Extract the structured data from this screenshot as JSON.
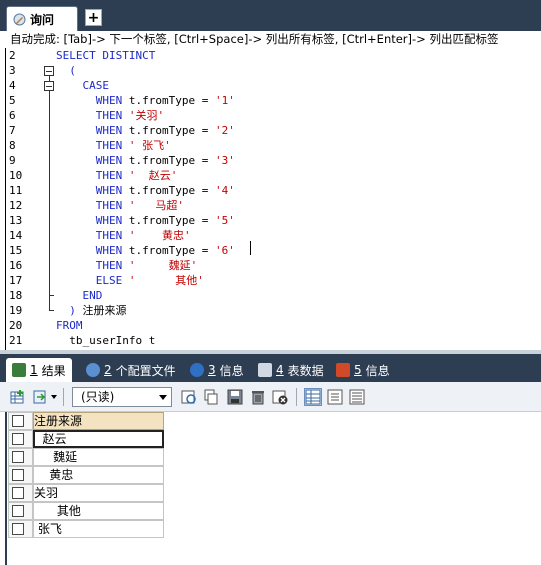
{
  "top_tab": {
    "label": "询问",
    "add_label": "+"
  },
  "hint": "自动完成: [Tab]-> 下一个标签, [Ctrl+Space]-> 列出所有标签, [Ctrl+Enter]-> 列出匹配标签",
  "code_lines": [
    {
      "n": "2",
      "parts": [
        {
          "t": "SELECT DISTINCT",
          "c": "kw"
        }
      ]
    },
    {
      "n": "3",
      "parts": [
        {
          "t": "  (",
          "c": "kw"
        }
      ]
    },
    {
      "n": "4",
      "parts": [
        {
          "t": "    CASE",
          "c": "kw"
        }
      ]
    },
    {
      "n": "5",
      "parts": [
        {
          "t": "      WHEN ",
          "c": "kw"
        },
        {
          "t": "t.fromType = ",
          "c": "plain"
        },
        {
          "t": "'1'",
          "c": "str"
        }
      ]
    },
    {
      "n": "6",
      "parts": [
        {
          "t": "      THEN ",
          "c": "kw"
        },
        {
          "t": "'关羽'",
          "c": "str"
        }
      ]
    },
    {
      "n": "7",
      "parts": [
        {
          "t": "      WHEN ",
          "c": "kw"
        },
        {
          "t": "t.fromType = ",
          "c": "plain"
        },
        {
          "t": "'2'",
          "c": "str"
        }
      ]
    },
    {
      "n": "8",
      "parts": [
        {
          "t": "      THEN ",
          "c": "kw"
        },
        {
          "t": "' 张飞'",
          "c": "str"
        }
      ]
    },
    {
      "n": "9",
      "parts": [
        {
          "t": "      WHEN ",
          "c": "kw"
        },
        {
          "t": "t.fromType = ",
          "c": "plain"
        },
        {
          "t": "'3'",
          "c": "str"
        }
      ]
    },
    {
      "n": "10",
      "parts": [
        {
          "t": "      THEN ",
          "c": "kw"
        },
        {
          "t": "'  赵云'",
          "c": "str"
        }
      ]
    },
    {
      "n": "11",
      "parts": [
        {
          "t": "      WHEN ",
          "c": "kw"
        },
        {
          "t": "t.fromType = ",
          "c": "plain"
        },
        {
          "t": "'4'",
          "c": "str"
        }
      ]
    },
    {
      "n": "12",
      "parts": [
        {
          "t": "      THEN ",
          "c": "kw"
        },
        {
          "t": "'   马超'",
          "c": "str"
        }
      ]
    },
    {
      "n": "13",
      "parts": [
        {
          "t": "      WHEN ",
          "c": "kw"
        },
        {
          "t": "t.fromType = ",
          "c": "plain"
        },
        {
          "t": "'5'",
          "c": "str"
        }
      ]
    },
    {
      "n": "14",
      "parts": [
        {
          "t": "      THEN ",
          "c": "kw"
        },
        {
          "t": "'    黄忠'",
          "c": "str"
        }
      ]
    },
    {
      "n": "15",
      "parts": [
        {
          "t": "      WHEN ",
          "c": "kw"
        },
        {
          "t": "t.fromType = ",
          "c": "plain"
        },
        {
          "t": "'6'",
          "c": "str"
        }
      ]
    },
    {
      "n": "16",
      "parts": [
        {
          "t": "      THEN ",
          "c": "kw"
        },
        {
          "t": "'     魏延'",
          "c": "str"
        }
      ]
    },
    {
      "n": "17",
      "parts": [
        {
          "t": "      ELSE ",
          "c": "kw"
        },
        {
          "t": "'      其他'",
          "c": "str"
        }
      ]
    },
    {
      "n": "18",
      "parts": [
        {
          "t": "    END",
          "c": "kw"
        }
      ]
    },
    {
      "n": "19",
      "parts": [
        {
          "t": "  ) ",
          "c": "kw"
        },
        {
          "t": "注册来源",
          "c": "plain"
        }
      ]
    },
    {
      "n": "20",
      "parts": [
        {
          "t": "FROM",
          "c": "kw"
        }
      ]
    },
    {
      "n": "21",
      "parts": [
        {
          "t": "  tb_userInfo t",
          "c": "plain"
        }
      ]
    }
  ],
  "result_tabs": [
    {
      "num": "1",
      "label": "结果",
      "icon": "result-grid-icon",
      "active": true
    },
    {
      "num": "2",
      "label": "个配置文件",
      "icon": "profile-icon",
      "active": false
    },
    {
      "num": "3",
      "label": "信息",
      "icon": "info-icon",
      "active": false
    },
    {
      "num": "4",
      "label": "表数据",
      "icon": "table-data-icon",
      "active": false
    },
    {
      "num": "5",
      "label": "信息",
      "icon": "info-chart-icon",
      "active": false
    }
  ],
  "toolbar": {
    "readonly_label": "(只读)"
  },
  "grid": {
    "header": "注册来源",
    "rows": [
      "  赵云",
      "     魏延",
      "    黄忠",
      "关羽",
      "      其他",
      " 张飞"
    ],
    "selected_row": 0
  },
  "colors": {
    "keyword": "#1c29c9",
    "string": "#c20000",
    "tabbar": "#2d3e52",
    "header_cell": "#f3e3c0"
  }
}
